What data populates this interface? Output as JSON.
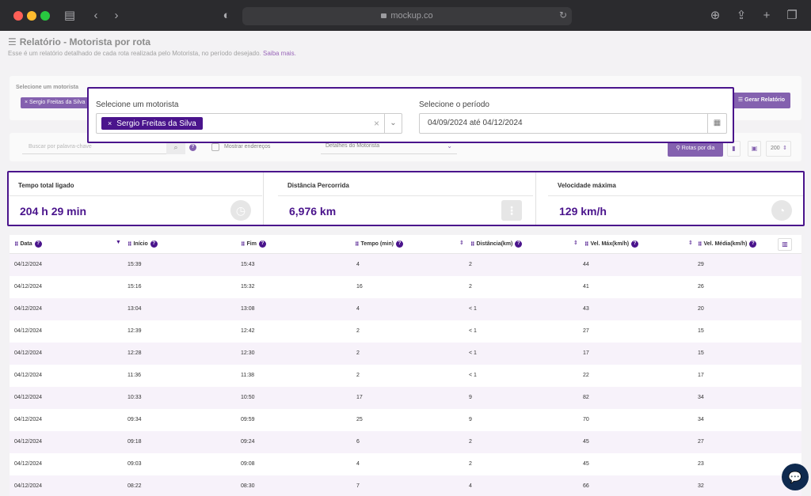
{
  "browser": {
    "url": "mockup.co",
    "icons": [
      "sidebar-icon",
      "back-icon",
      "forward-icon",
      "shield-icon",
      "download-icon",
      "share-icon",
      "new-tab-icon",
      "tabs-icon"
    ]
  },
  "header": {
    "title": "Relatório - Motorista por rota",
    "subtitle": "Esse é um relatório detalhado de cada rota realizada pelo Motorista, no período desejado.",
    "link": "Saiba mais."
  },
  "filters_bg": {
    "driver_label": "Selecione um motorista",
    "driver_chip": "Sergio Freitas da Silva",
    "generate_button": "Gerar Relatório"
  },
  "toolbar": {
    "search_placeholder": "Buscar por palavra-chave",
    "show_addresses": "Mostrar endereços",
    "details_select": "Detalhes do Motorista",
    "routes_button": "Rotas por dia",
    "per_page": "200"
  },
  "popup": {
    "driver_label": "Selecione um motorista",
    "driver_value": "Sergio Freitas da Silva",
    "period_label": "Selecione o período",
    "date_from": "04/09/2024",
    "date_sep": "até",
    "date_to": "04/12/2024"
  },
  "stats": [
    {
      "label": "Tempo total ligado",
      "value": "204 h 29 min",
      "icon": "clock-icon"
    },
    {
      "label": "Distância Percorrida",
      "value": "6,976 km",
      "icon": "road-icon"
    },
    {
      "label": "Velocidade máxima",
      "value": "129 km/h",
      "icon": "speedometer-icon"
    }
  ],
  "table": {
    "headers": [
      "Data",
      "Início",
      "Fim",
      "Tempo (min)",
      "Distância(km)",
      "Vel. Máx(km/h)",
      "Vel. Média(km/h)"
    ],
    "rows": [
      [
        "04/12/2024",
        "15:39",
        "15:43",
        "4",
        "2",
        "44",
        "29"
      ],
      [
        "04/12/2024",
        "15:16",
        "15:32",
        "16",
        "2",
        "41",
        "26"
      ],
      [
        "04/12/2024",
        "13:04",
        "13:08",
        "4",
        "< 1",
        "43",
        "20"
      ],
      [
        "04/12/2024",
        "12:39",
        "12:42",
        "2",
        "< 1",
        "27",
        "15"
      ],
      [
        "04/12/2024",
        "12:28",
        "12:30",
        "2",
        "< 1",
        "17",
        "15"
      ],
      [
        "04/12/2024",
        "11:36",
        "11:38",
        "2",
        "< 1",
        "22",
        "17"
      ],
      [
        "04/12/2024",
        "10:33",
        "10:50",
        "17",
        "9",
        "82",
        "34"
      ],
      [
        "04/12/2024",
        "09:34",
        "09:59",
        "25",
        "9",
        "70",
        "34"
      ],
      [
        "04/12/2024",
        "09:18",
        "09:24",
        "6",
        "2",
        "45",
        "27"
      ],
      [
        "04/12/2024",
        "09:03",
        "09:08",
        "4",
        "2",
        "45",
        "23"
      ],
      [
        "04/12/2024",
        "08:22",
        "08:30",
        "7",
        "4",
        "66",
        "32"
      ]
    ]
  },
  "colors": {
    "brand": "#4a148c",
    "chrome": "#2b2b2e",
    "row_alt": "#f7f2fa"
  }
}
